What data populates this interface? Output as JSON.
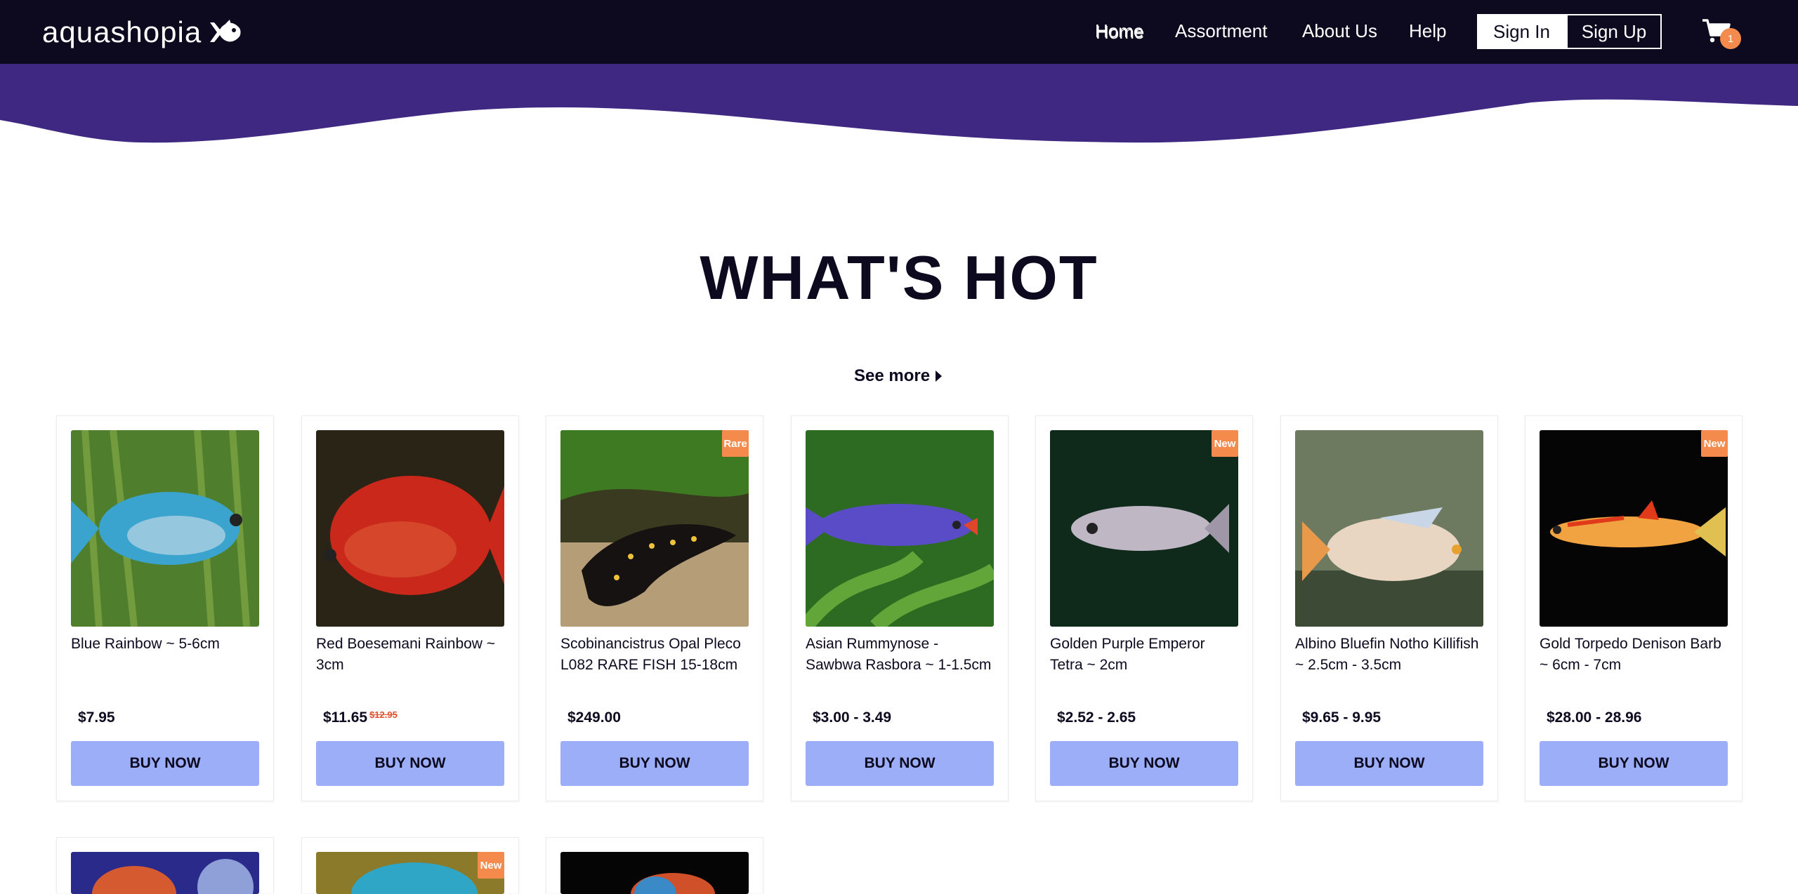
{
  "brand": {
    "name": "aquashopia"
  },
  "nav": {
    "links": [
      "Home",
      "Assortment",
      "About Us",
      "Help"
    ],
    "sign_in": "Sign In",
    "sign_up": "Sign Up",
    "cart_count": "1"
  },
  "colors": {
    "nav_bg": "#0d0a1f",
    "wave": "#3f2882",
    "accent": "#f48a4b",
    "buy_button": "#9baef7"
  },
  "section": {
    "title": "WHAT'S HOT",
    "see_more": "See more"
  },
  "products": [
    {
      "name": "Blue Rainbow ~ 5-6cm",
      "price": "$7.95",
      "old_price": "",
      "badge": "",
      "button": "BUY NOW"
    },
    {
      "name": "Red Boesemani Rainbow ~ 3cm",
      "price": "$11.65",
      "old_price": "$12.95",
      "badge": "",
      "button": "BUY NOW"
    },
    {
      "name": "Scobinancistrus Opal Pleco L082 RARE FISH 15-18cm",
      "price": "$249.00",
      "old_price": "",
      "badge": "Rare",
      "button": "BUY NOW"
    },
    {
      "name": "Asian Rummynose - Sawbwa Rasbora ~ 1-1.5cm",
      "price": "$3.00 - 3.49",
      "old_price": "",
      "badge": "",
      "button": "BUY NOW"
    },
    {
      "name": "Golden Purple Emperor Tetra ~ 2cm",
      "price": "$2.52 - 2.65",
      "old_price": "",
      "badge": "New",
      "button": "BUY NOW"
    },
    {
      "name": "Albino Bluefin Notho Killifish ~ 2.5cm - 3.5cm",
      "price": "$9.65 - 9.95",
      "old_price": "",
      "badge": "",
      "button": "BUY NOW"
    },
    {
      "name": "Gold Torpedo Denison Barb ~ 6cm - 7cm",
      "price": "$28.00 - 28.96",
      "old_price": "",
      "badge": "New",
      "button": "BUY NOW"
    }
  ],
  "second_row_badges": [
    "",
    "New",
    ""
  ]
}
